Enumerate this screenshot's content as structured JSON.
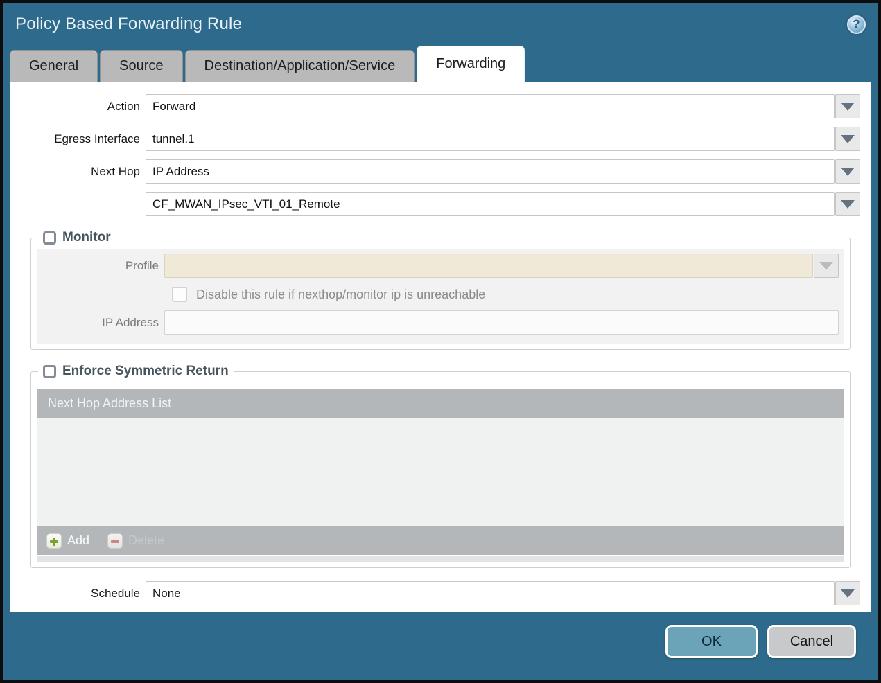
{
  "dialog": {
    "title": "Policy Based Forwarding Rule",
    "help_glyph": "?"
  },
  "tabs": [
    {
      "label": "General",
      "active": false
    },
    {
      "label": "Source",
      "active": false
    },
    {
      "label": "Destination/Application/Service",
      "active": false
    },
    {
      "label": "Forwarding",
      "active": true
    }
  ],
  "form": {
    "action": {
      "label": "Action",
      "value": "Forward"
    },
    "egress_interface": {
      "label": "Egress Interface",
      "value": "tunnel.1"
    },
    "next_hop": {
      "label": "Next Hop",
      "value": "IP Address"
    },
    "next_hop_address": {
      "value": "CF_MWAN_IPsec_VTI_01_Remote"
    },
    "schedule": {
      "label": "Schedule",
      "value": "None"
    }
  },
  "monitor": {
    "legend": "Monitor",
    "checked": false,
    "profile": {
      "label": "Profile",
      "value": ""
    },
    "disable_rule": {
      "label": "Disable this rule if nexthop/monitor ip is unreachable",
      "checked": false
    },
    "ip_address": {
      "label": "IP Address",
      "value": ""
    }
  },
  "enforce_symmetric_return": {
    "legend": "Enforce Symmetric Return",
    "checked": false,
    "table_header": "Next Hop Address List",
    "rows": [],
    "add_label": "Add",
    "delete_label": "Delete",
    "delete_enabled": false
  },
  "footer": {
    "ok_label": "OK",
    "cancel_label": "Cancel"
  },
  "colors": {
    "titlebar_teal": "#2e6a8c",
    "ok_button": "#6ba3b9",
    "cancel_button": "#c7c9cb",
    "profile_disabled_cream": "#f0e9d7",
    "table_header_gray": "#b3b7ba",
    "add_plus_green": "#7da035",
    "delete_minus_red": "#cc838a"
  }
}
